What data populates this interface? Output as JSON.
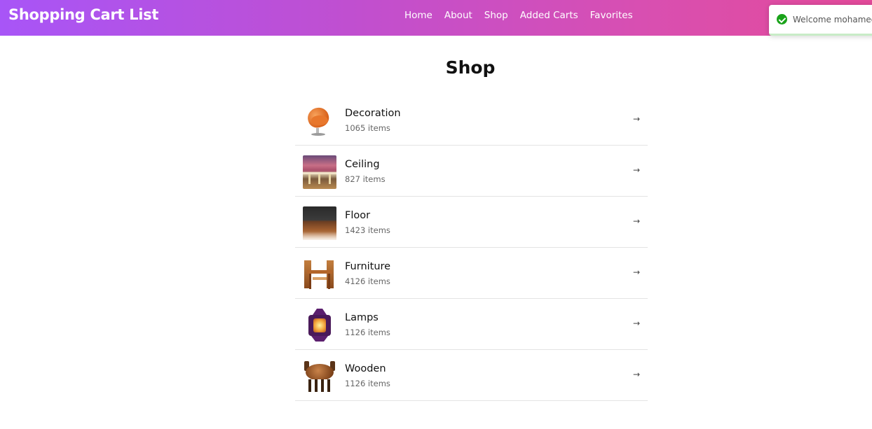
{
  "navbar": {
    "brand": "Shopping Cart List",
    "links": [
      "Home",
      "About",
      "Shop",
      "Added Carts",
      "Favorites"
    ]
  },
  "toast": {
    "message": "Welcome mohamed@",
    "icon": "check-circle-icon",
    "status_color": "#1aa31a"
  },
  "page": {
    "title": "Shop"
  },
  "categories": [
    {
      "name": "Decoration",
      "count": "1065 items",
      "image": "armchair-image"
    },
    {
      "name": "Ceiling",
      "count": "827 items",
      "image": "ceiling-image"
    },
    {
      "name": "Floor",
      "count": "1423 items",
      "image": "floor-image"
    },
    {
      "name": "Furniture",
      "count": "4126 items",
      "image": "dining-set-image"
    },
    {
      "name": "Lamps",
      "count": "1126 items",
      "image": "lantern-image"
    },
    {
      "name": "Wooden",
      "count": "1126 items",
      "image": "wooden-table-image"
    }
  ],
  "row_arrow": "→",
  "colors": {
    "navbar_gradient_start": "#a855f7",
    "navbar_gradient_end": "#e34a9a"
  }
}
